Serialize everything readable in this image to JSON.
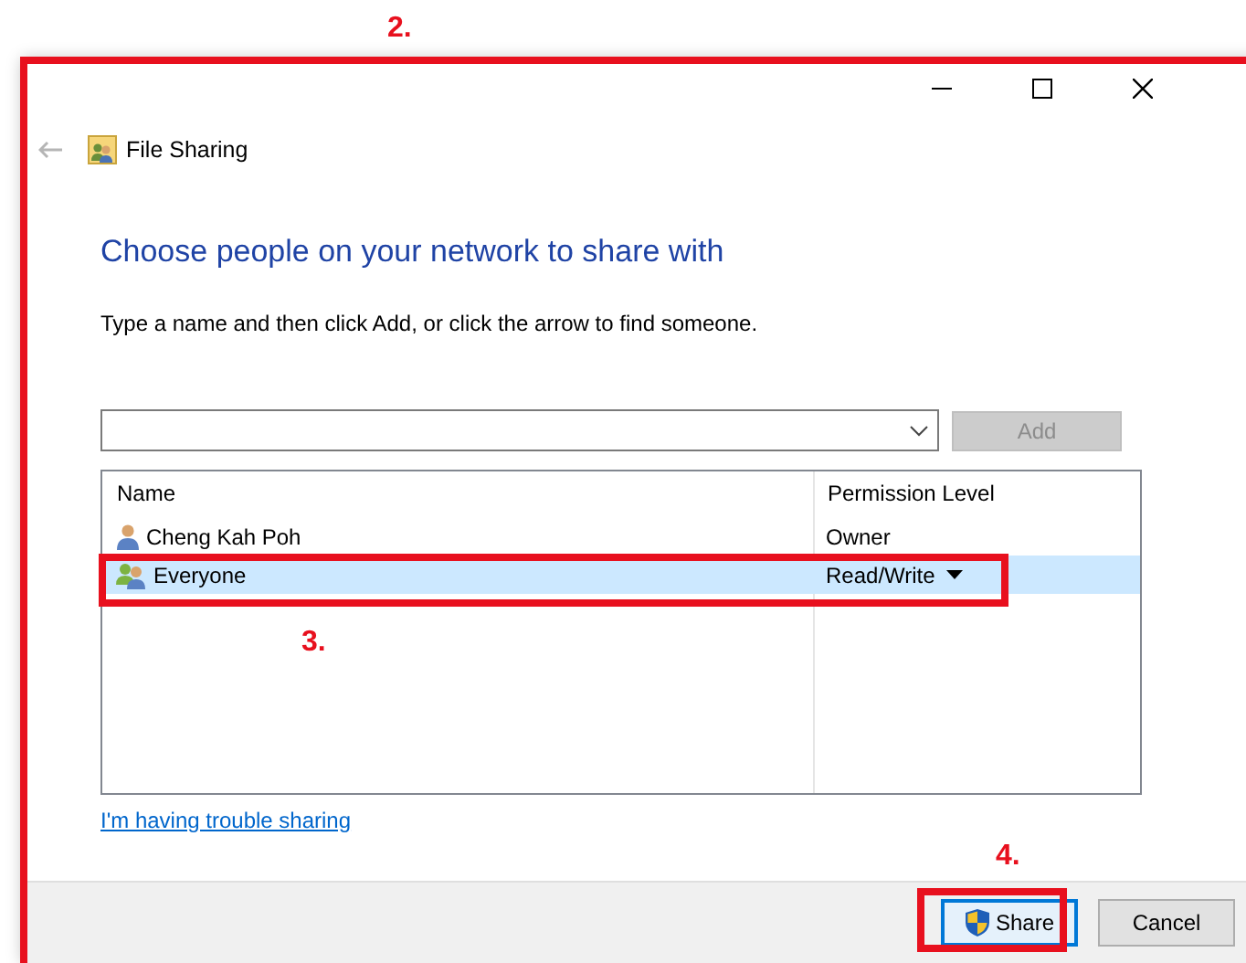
{
  "annotations": [
    {
      "label": "2.",
      "kind": "window"
    },
    {
      "label": "3.",
      "kind": "row"
    },
    {
      "label": "4.",
      "kind": "button"
    }
  ],
  "window": {
    "title": "File Sharing"
  },
  "heading": "Choose people on your network to share with",
  "instruction": "Type a name and then click Add, or click the arrow to find someone.",
  "add_button": {
    "label": "Add",
    "disabled": true
  },
  "list": {
    "columns": [
      "Name",
      "Permission Level"
    ],
    "rows": [
      {
        "name": "Cheng Kah Poh",
        "kind": "user",
        "permission": "Owner",
        "dropdown": false,
        "selected": false
      },
      {
        "name": "Everyone",
        "kind": "group",
        "permission": "Read/Write",
        "dropdown": true,
        "selected": true
      }
    ]
  },
  "link": "I'm having trouble sharing",
  "buttons": [
    {
      "label": "Share",
      "kind": "shield",
      "default": true
    },
    {
      "label": "Cancel",
      "kind": "plain",
      "default": false
    }
  ]
}
